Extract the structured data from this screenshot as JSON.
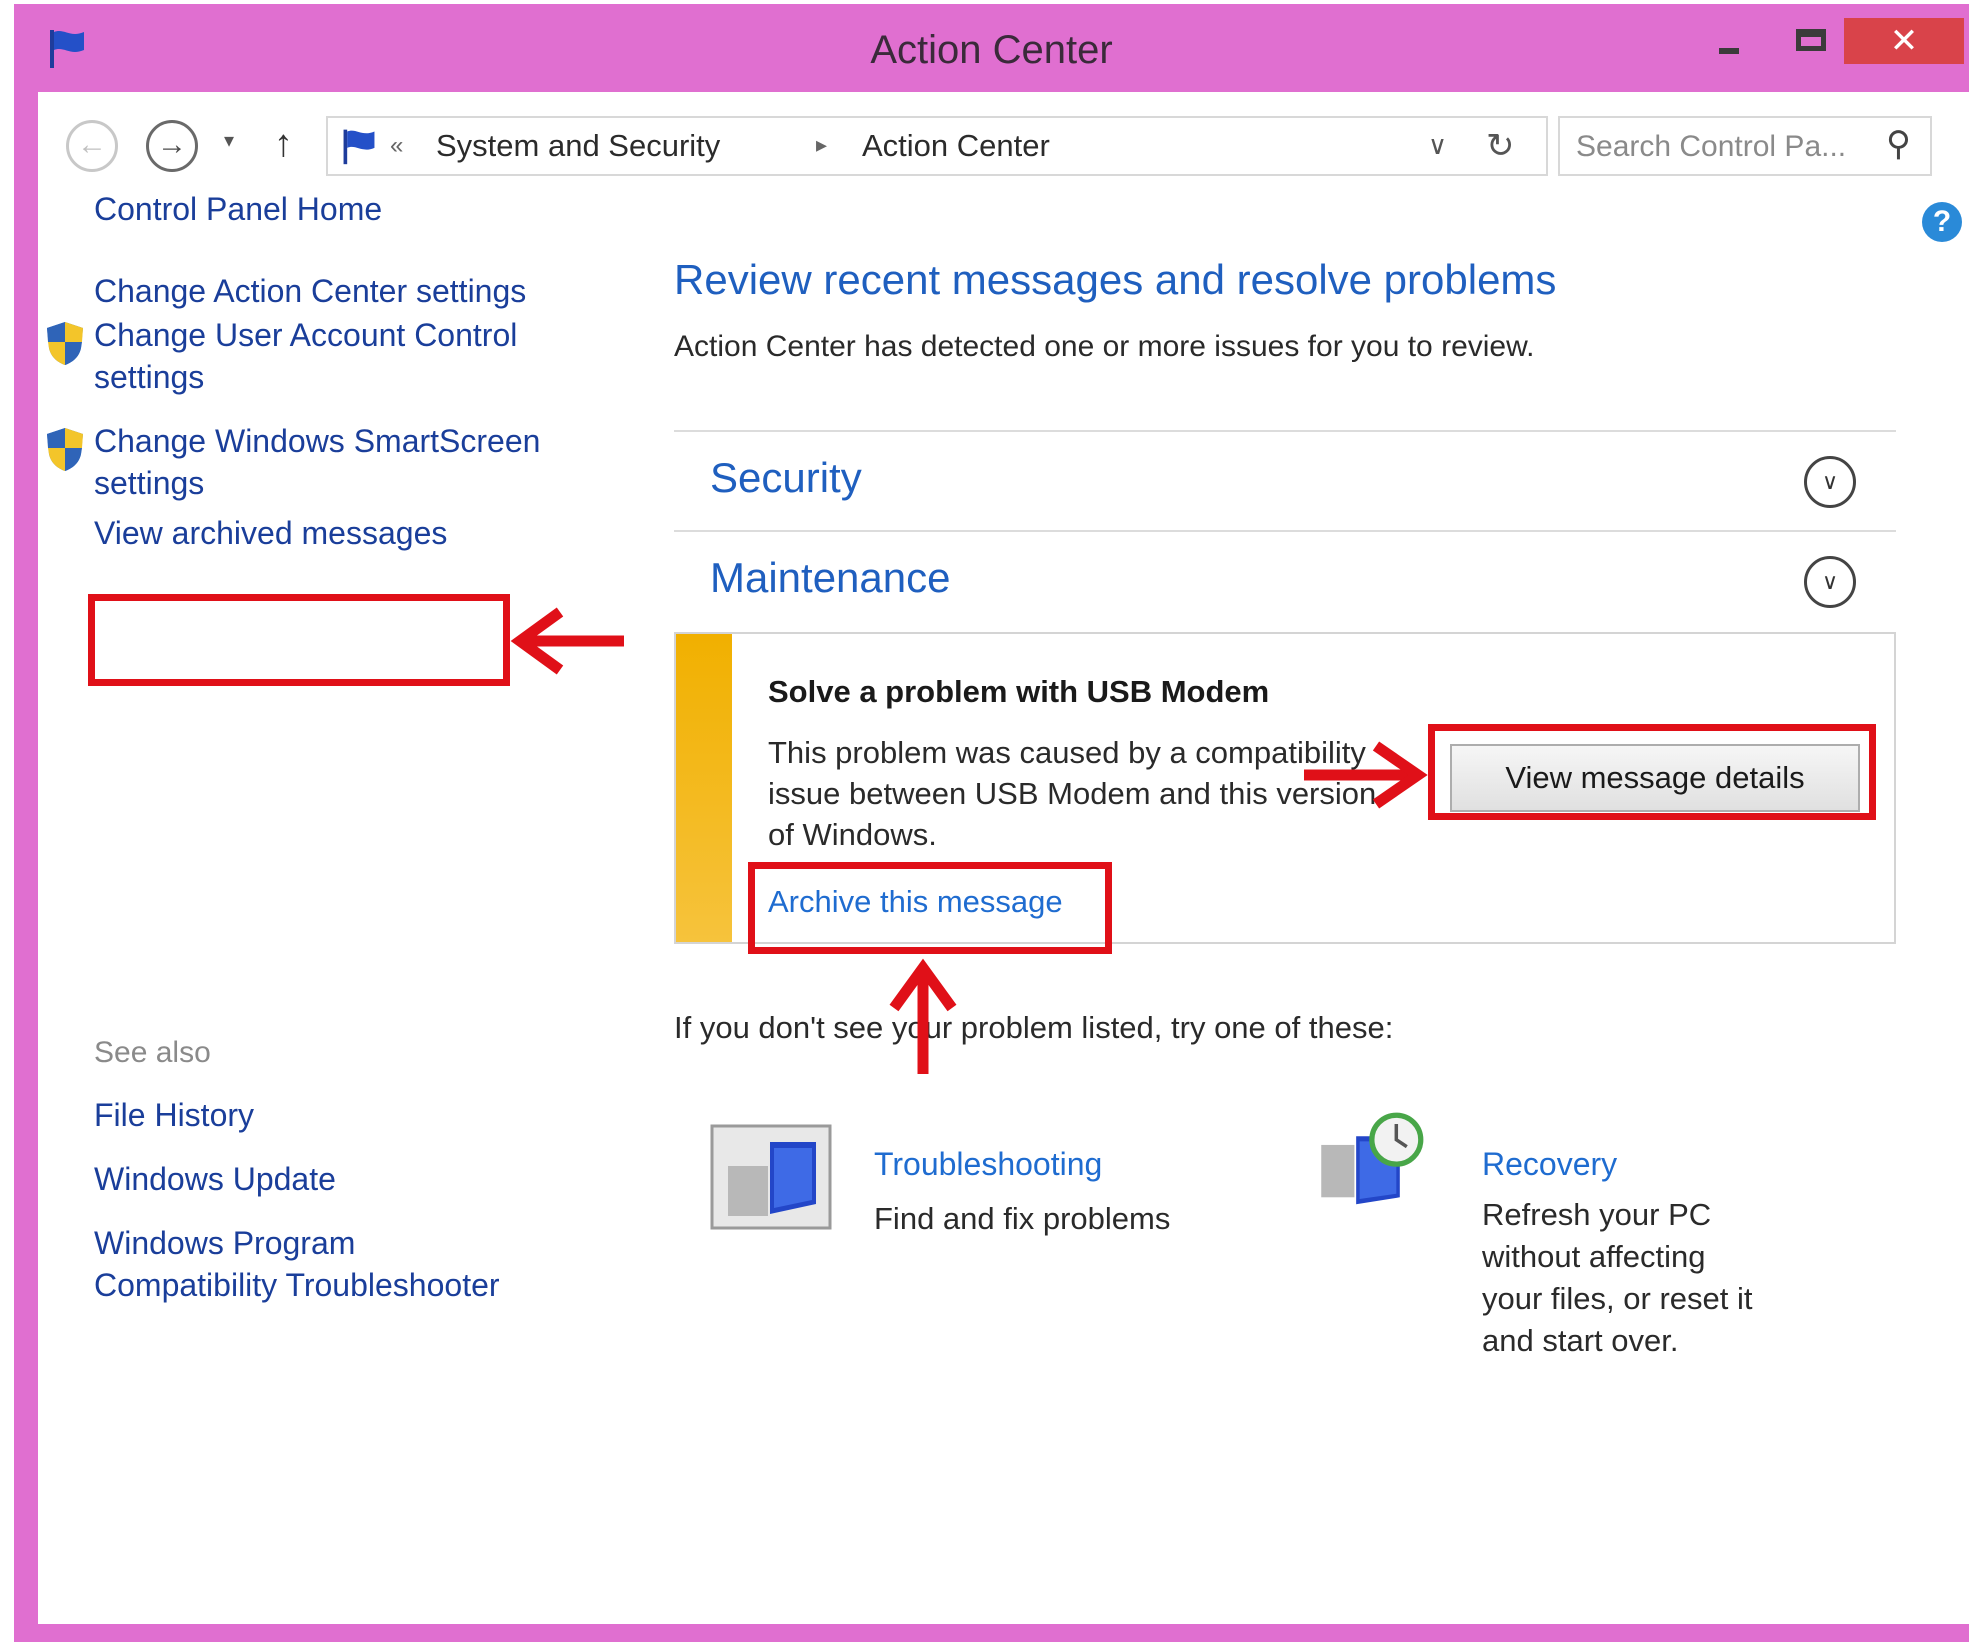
{
  "window": {
    "title": "Action Center",
    "controls": {
      "minimize": "",
      "maximize": "",
      "close": "✕"
    }
  },
  "nav": {
    "back_glyph": "←",
    "forward_glyph": "→",
    "recent_glyph": "▾",
    "up_glyph": "↑"
  },
  "address": {
    "overflow_glyph": "«",
    "breadcrumbs": [
      "System and Security",
      "Action Center"
    ],
    "separator_glyph": "▸",
    "dropdown_glyph": "∨",
    "refresh_glyph": "↻"
  },
  "search": {
    "placeholder": "Search Control Pa...",
    "value": "",
    "icon_glyph": "⚲"
  },
  "help": {
    "glyph": "?"
  },
  "sidebar": {
    "home": "Control Panel Home",
    "links": [
      {
        "label": "Change Action Center settings",
        "shield": false
      },
      {
        "label_line1": "Change User Account Control",
        "label_line2": "settings",
        "shield": true
      },
      {
        "label_line1": "Change Windows SmartScreen",
        "label_line2": "settings",
        "shield": true
      },
      {
        "label": "View archived messages",
        "shield": false
      }
    ],
    "see_also_heading": "See also",
    "see_also": [
      {
        "label": "File History"
      },
      {
        "label": "Windows Update"
      },
      {
        "label_line1": "Windows Program",
        "label_line2": "Compatibility Troubleshooter"
      }
    ]
  },
  "main": {
    "heading": "Review recent messages and resolve problems",
    "subtitle": "Action Center has detected one or more issues for you to review.",
    "sections": [
      {
        "title": "Security",
        "chevron_glyph": "∨"
      },
      {
        "title": "Maintenance",
        "chevron_glyph": "∨"
      }
    ],
    "message": {
      "title": "Solve a problem with USB Modem",
      "body_line1": "This problem was caused by a compatibility",
      "body_line2": "issue between USB Modem and this version",
      "body_line3": "of Windows.",
      "archive_link": "Archive this message",
      "details_button": "View message details",
      "stripe_color": "#f1b000"
    },
    "hint": "If you don't see your problem listed, try one of these:",
    "tools": [
      {
        "title": "Troubleshooting",
        "desc_line1": "Find and fix problems",
        "icon": "troubleshooting-icon"
      },
      {
        "title": "Recovery",
        "desc_line1": "Refresh your PC",
        "desc_line2": "without affecting",
        "desc_line3": "your files, or reset it",
        "desc_line4": "and start over.",
        "icon": "recovery-icon"
      }
    ]
  },
  "colors": {
    "frame": "#e06fd0",
    "link": "#1a3e9a",
    "heading": "#1f5fbf",
    "annotation": "#e01018",
    "close_button": "#d9434a"
  }
}
